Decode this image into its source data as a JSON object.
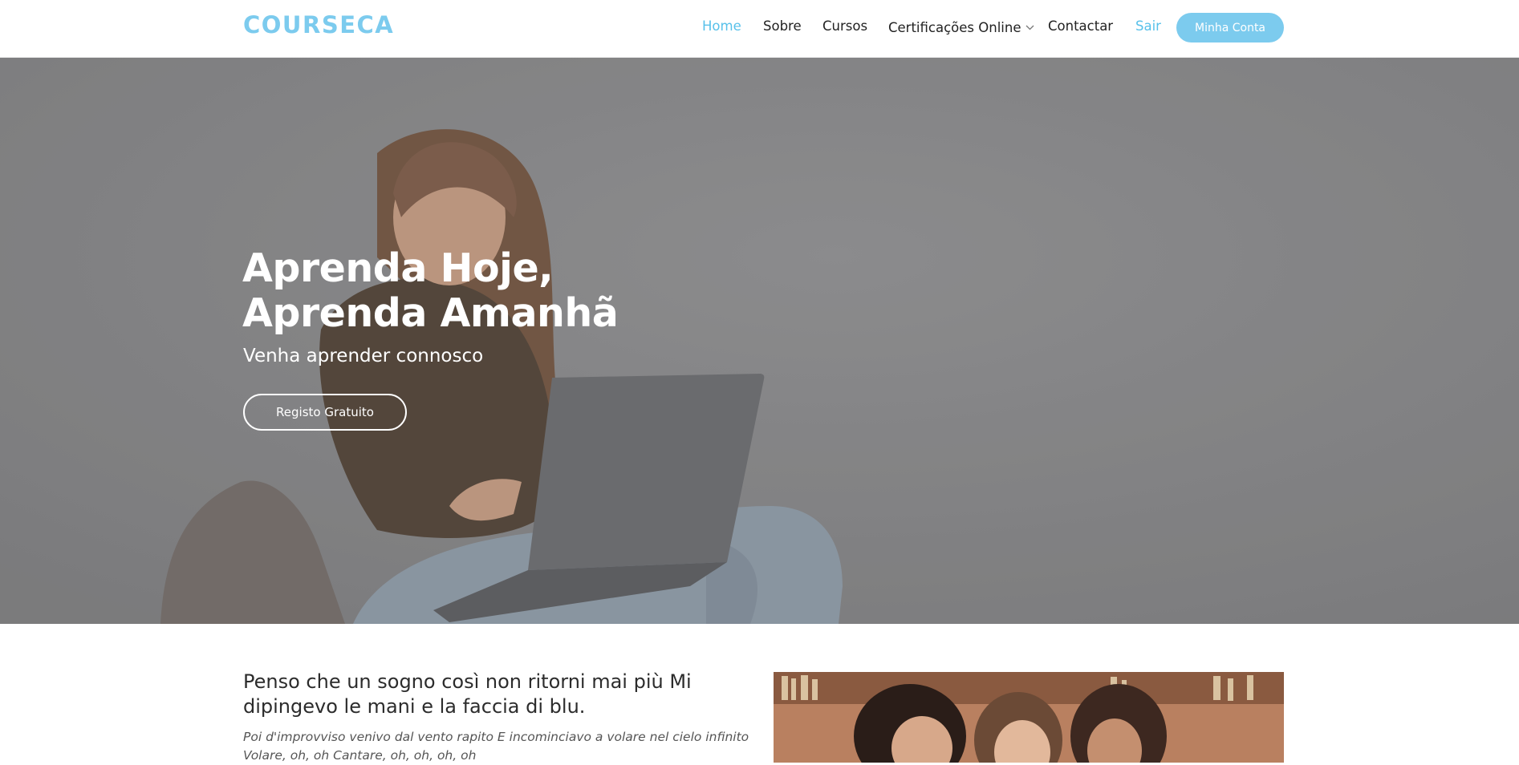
{
  "header": {
    "logo": "COURSECA",
    "nav": [
      {
        "label": "Home"
      },
      {
        "label": "Sobre"
      },
      {
        "label": "Cursos"
      },
      {
        "label": "Certificações Online"
      },
      {
        "label": "Contactar"
      },
      {
        "label": "Sair"
      }
    ],
    "account_button": "Minha Conta"
  },
  "hero": {
    "title_line1": "Aprenda Hoje,",
    "title_line2": "Aprenda Amanhã",
    "subtitle": "Venha aprender connosco",
    "cta": "Registo Gratuito"
  },
  "intro": {
    "heading": "Penso che un sogno così non ritorni mai più Mi dipingevo le mani e la faccia di blu.",
    "text": "Poi d'improvviso venivo dal vento rapito E incominciavo a volare nel cielo infinito Volare, oh, oh Cantare, oh, oh, oh, oh"
  },
  "colors": {
    "accent": "#58c1ea",
    "button": "#7ccbee",
    "hero_overlay": "#7d7d7f"
  },
  "icons": {
    "dropdown": "chevron-down-icon"
  }
}
